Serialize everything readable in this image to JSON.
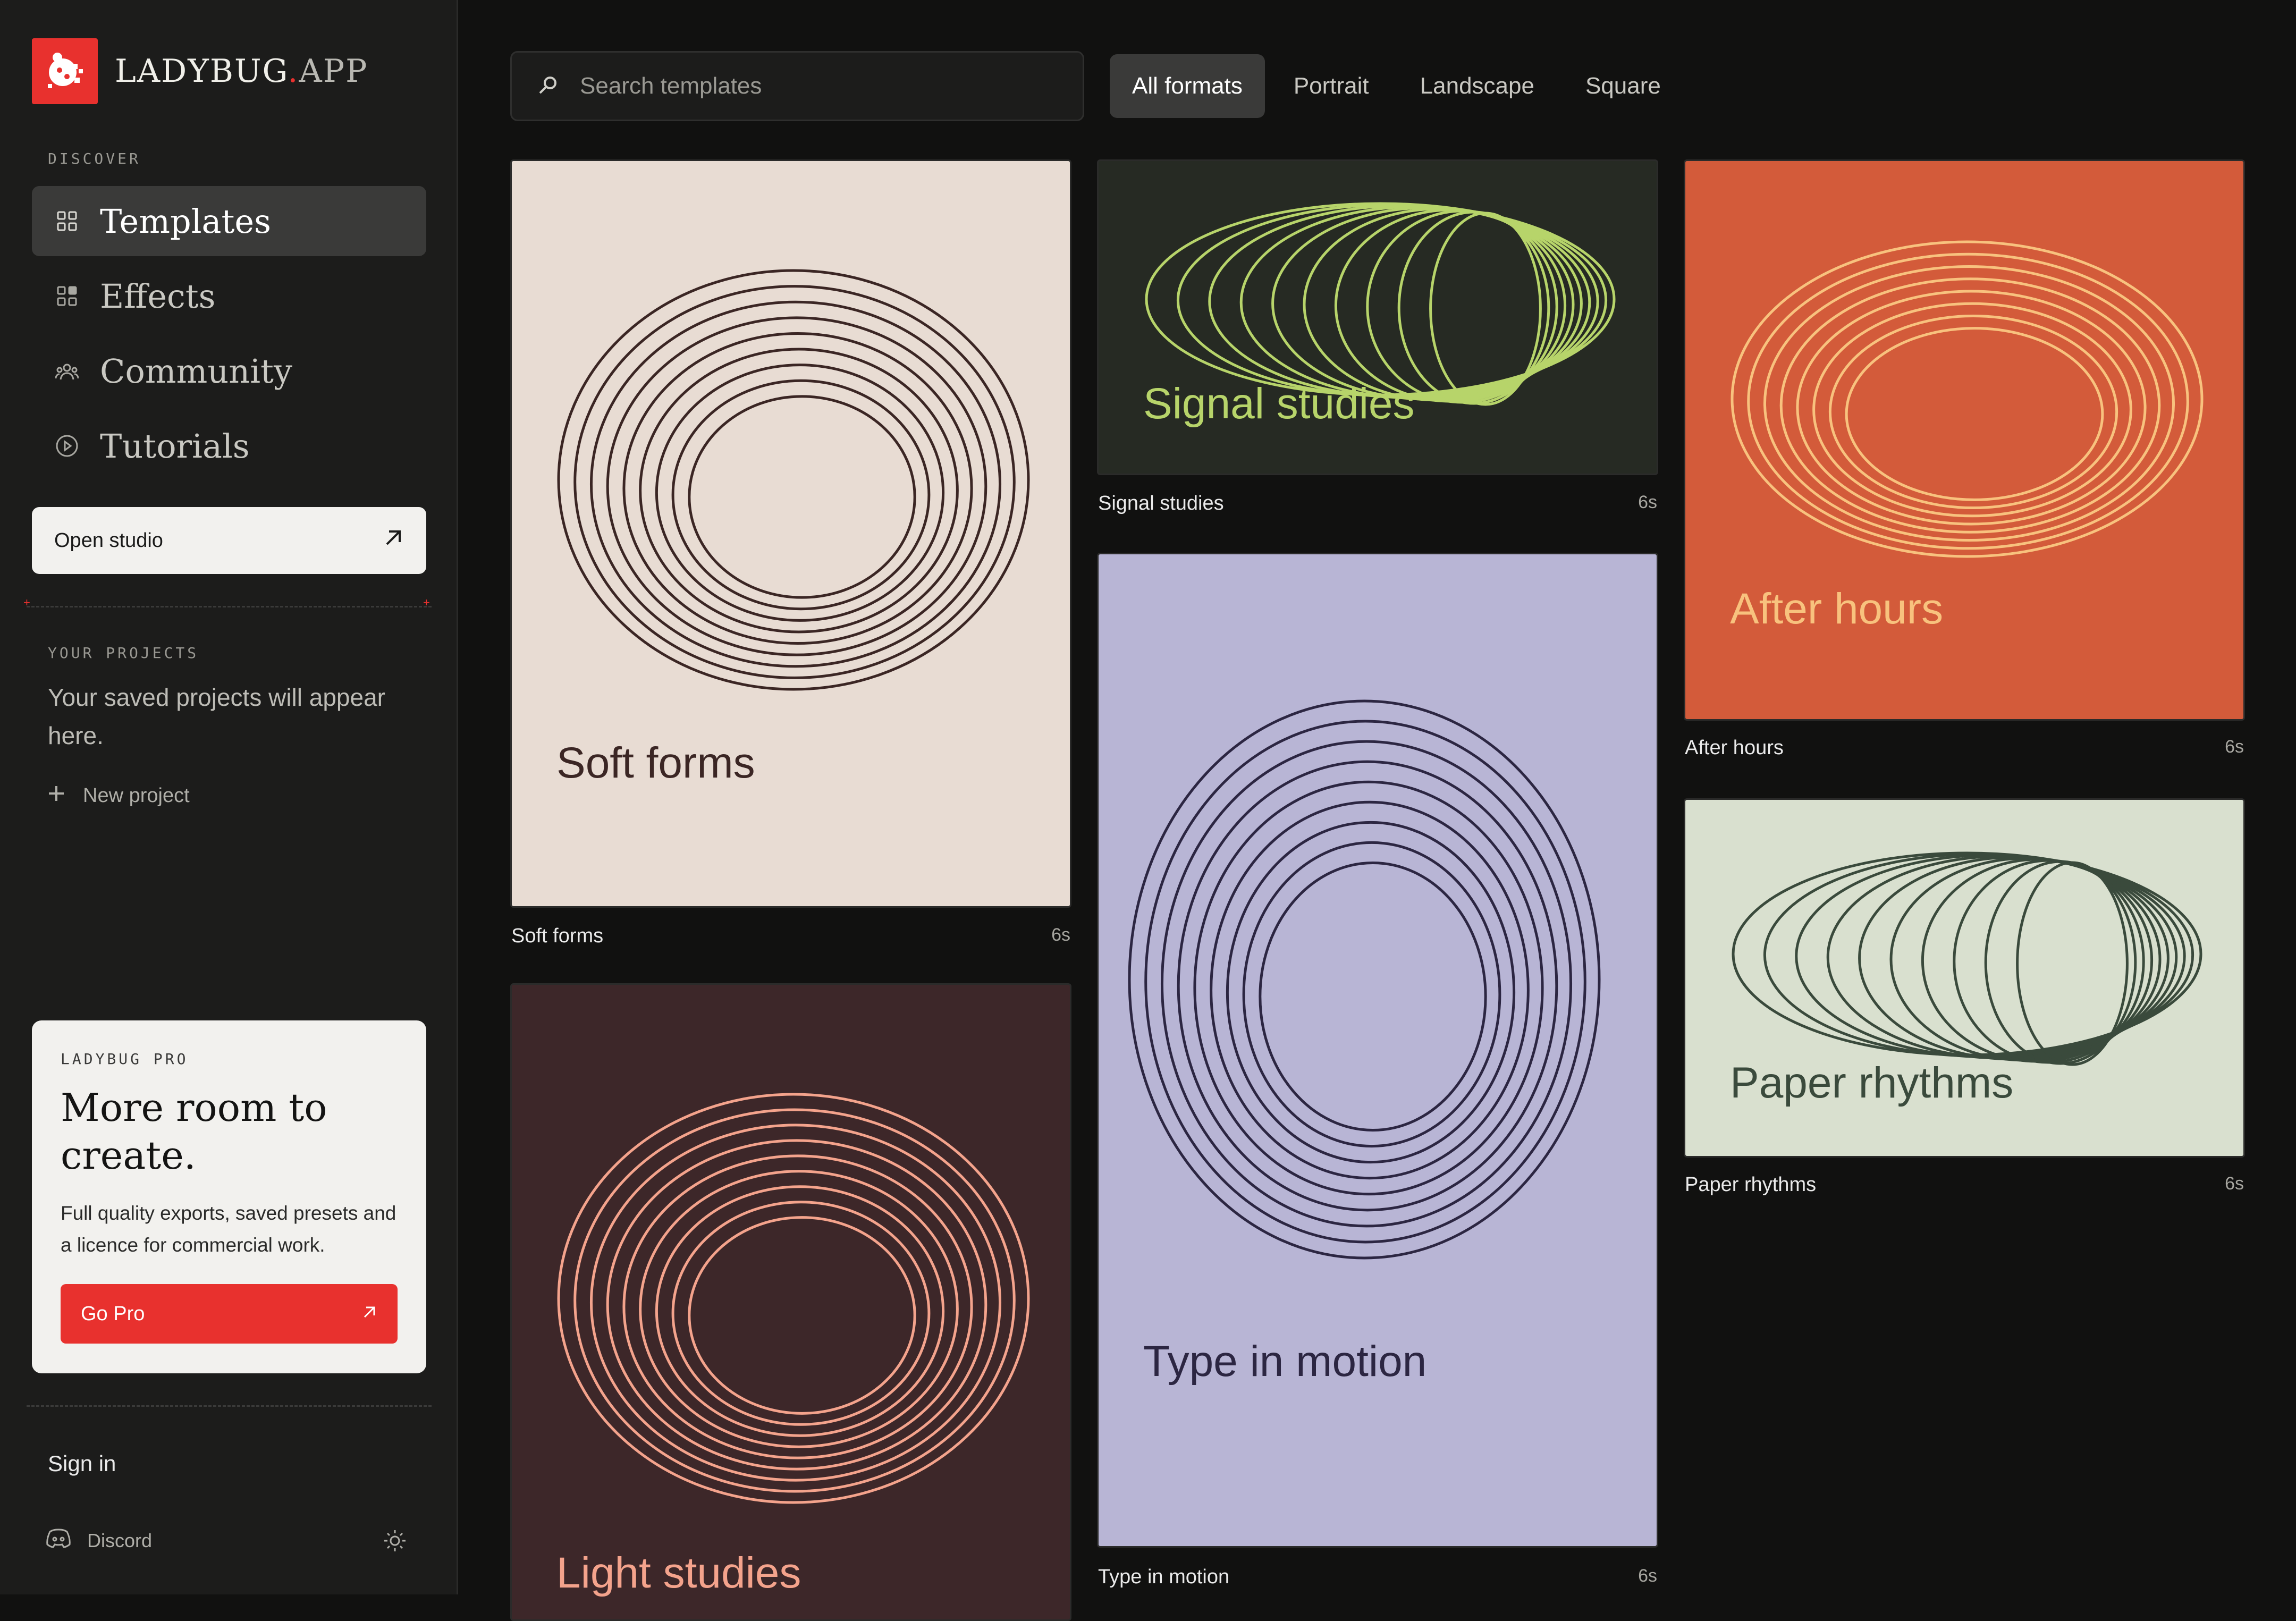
{
  "brand": {
    "name": "LADYBUG",
    "dot": ".",
    "suffix": "APP",
    "accent": "#e8312e"
  },
  "sidebar": {
    "discover_label": "DISCOVER",
    "nav": [
      {
        "label": "Templates",
        "icon": "grid-icon",
        "active": true
      },
      {
        "label": "Effects",
        "icon": "effects-grid-icon",
        "active": false
      },
      {
        "label": "Community",
        "icon": "people-icon",
        "active": false
      },
      {
        "label": "Tutorials",
        "icon": "play-circle-icon",
        "active": false
      }
    ],
    "open_studio": {
      "label": "Open studio",
      "icon": "arrow-up-right-icon"
    },
    "projects_label": "YOUR PROJECTS",
    "projects_empty": "Your saved projects will appear here.",
    "new_project": {
      "label": "New project",
      "icon": "plus-icon"
    },
    "pro": {
      "label": "LADYBUG PRO",
      "title": "More room to create.",
      "description": "Full quality exports, saved presets and a licence for commercial work.",
      "button": "Go Pro",
      "button_icon": "arrow-up-right-icon"
    },
    "sign_in": "Sign in",
    "discord": {
      "label": "Discord",
      "icon": "discord-icon"
    },
    "theme_icon": "sun-icon"
  },
  "search": {
    "placeholder": "Search templates",
    "value": "",
    "icon": "search-icon"
  },
  "filters": [
    {
      "label": "All formats",
      "active": true
    },
    {
      "label": "Portrait",
      "active": false
    },
    {
      "label": "Landscape",
      "active": false
    },
    {
      "label": "Square",
      "active": false
    }
  ],
  "templates": [
    {
      "title": "Soft forms",
      "name": "Soft forms",
      "duration": "6s",
      "bg": "#e8dcd3",
      "fg": "#3b2624"
    },
    {
      "title": "Light studies",
      "name": "Light studies",
      "duration": "",
      "bg": "#3d2729",
      "fg": "#f4a38c"
    },
    {
      "title": "Signal studies",
      "name": "Signal studies",
      "duration": "6s",
      "bg": "#262a23",
      "fg": "#b7d46a"
    },
    {
      "title": "Type in motion",
      "name": "Type in motion",
      "duration": "6s",
      "bg": "#b8b5d5",
      "fg": "#2c2642"
    },
    {
      "title": "After hours",
      "name": "After hours",
      "duration": "6s",
      "bg": "#d35b3a",
      "fg": "#f8c27e"
    },
    {
      "title": "Paper rhythms",
      "name": "Paper rhythms",
      "duration": "6s",
      "bg": "#d9e0cf",
      "fg": "#3a4a3c"
    }
  ]
}
